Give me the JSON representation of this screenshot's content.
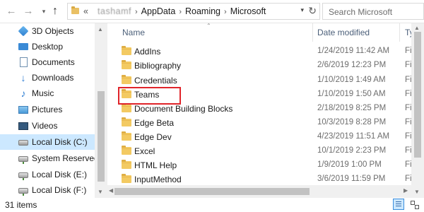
{
  "address": {
    "path": [
      {
        "label": "«",
        "kind": "overflow"
      },
      {
        "label": "tashamf",
        "kind": "redacted"
      },
      {
        "label": "AppData",
        "kind": "segment"
      },
      {
        "label": "Roaming",
        "kind": "segment"
      },
      {
        "label": "Microsoft",
        "kind": "segment"
      }
    ],
    "search_placeholder": "Search Microsoft"
  },
  "nav": {
    "items": [
      {
        "label": "3D Objects",
        "icon": "cube-3d-icon"
      },
      {
        "label": "Desktop",
        "icon": "desktop-icon"
      },
      {
        "label": "Documents",
        "icon": "documents-icon"
      },
      {
        "label": "Downloads",
        "icon": "downloads-icon"
      },
      {
        "label": "Music",
        "icon": "music-icon"
      },
      {
        "label": "Pictures",
        "icon": "pictures-icon"
      },
      {
        "label": "Videos",
        "icon": "videos-icon"
      },
      {
        "label": "Local Disk (C:)",
        "icon": "local-disk-icon",
        "selected": true
      },
      {
        "label": "System Reserved (",
        "icon": "drive-icon"
      },
      {
        "label": "Local Disk (E:)",
        "icon": "drive-icon"
      },
      {
        "label": "Local Disk (F:)",
        "icon": "drive-icon"
      }
    ]
  },
  "columns": {
    "name": "Name",
    "date": "Date modified",
    "type": "Ty"
  },
  "files": [
    {
      "name": "AddIns",
      "date": "1/24/2019 11:42 AM",
      "type": "Fi"
    },
    {
      "name": "Bibliography",
      "date": "2/6/2019 12:23 PM",
      "type": "Fi"
    },
    {
      "name": "Credentials",
      "date": "1/10/2019 1:49 AM",
      "type": "Fi"
    },
    {
      "name": "Teams",
      "date": "1/10/2019 1:50 AM",
      "type": "Fi",
      "highlighted": true
    },
    {
      "name": "Document Building Blocks",
      "date": "2/18/2019 8:25 PM",
      "type": "Fi"
    },
    {
      "name": "Edge Beta",
      "date": "10/3/2019 8:28 PM",
      "type": "Fi"
    },
    {
      "name": "Edge Dev",
      "date": "4/23/2019 11:51 AM",
      "type": "Fi"
    },
    {
      "name": "Excel",
      "date": "10/1/2019 2:23 PM",
      "type": "Fi"
    },
    {
      "name": "HTML Help",
      "date": "1/9/2019 1:00 PM",
      "type": "Fi"
    },
    {
      "name": "InputMethod",
      "date": "3/6/2019 11:59 PM",
      "type": "Fi"
    }
  ],
  "status": {
    "item_count": "31 items"
  },
  "colors": {
    "selection": "#cce8ff",
    "highlight_box": "#e0242a",
    "folder": "#f3ca62"
  }
}
